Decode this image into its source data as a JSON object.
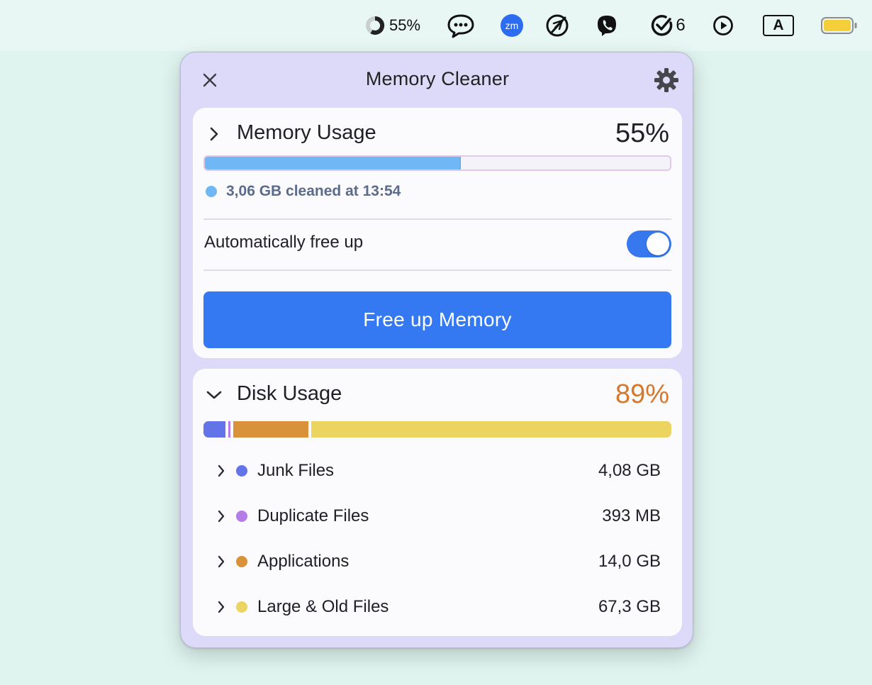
{
  "menubar": {
    "memory_percent": "55%",
    "tasks_count": "6",
    "input_source": "A",
    "zoom_label": "zm"
  },
  "popover": {
    "title": "Memory Cleaner"
  },
  "memory": {
    "title": "Memory Usage",
    "percent_label": "55%",
    "used_fraction": 0.55,
    "cleaned_text": "3,06 GB cleaned at 13:54",
    "auto_free_label": "Automatically free up",
    "auto_free_enabled": true,
    "button_label": "Free up Memory"
  },
  "disk": {
    "title": "Disk Usage",
    "percent_label": "89%",
    "items": [
      {
        "label": "Junk Files",
        "size": "4,08 GB",
        "gb": 4.08,
        "color": "#6274e8"
      },
      {
        "label": "Duplicate Files",
        "size": "393 MB",
        "gb": 0.393,
        "color": "#b57be6"
      },
      {
        "label": "Applications",
        "size": "14,0 GB",
        "gb": 14.0,
        "color": "#d9913a"
      },
      {
        "label": "Large & Old Files",
        "size": "67,3 GB",
        "gb": 67.3,
        "color": "#ecd460"
      }
    ]
  },
  "colors": {
    "accent": "#3478f2",
    "memory_bar": "#6fb8f5",
    "disk_percent": "#d5782b",
    "memory_dot": "#6fb8f5"
  }
}
